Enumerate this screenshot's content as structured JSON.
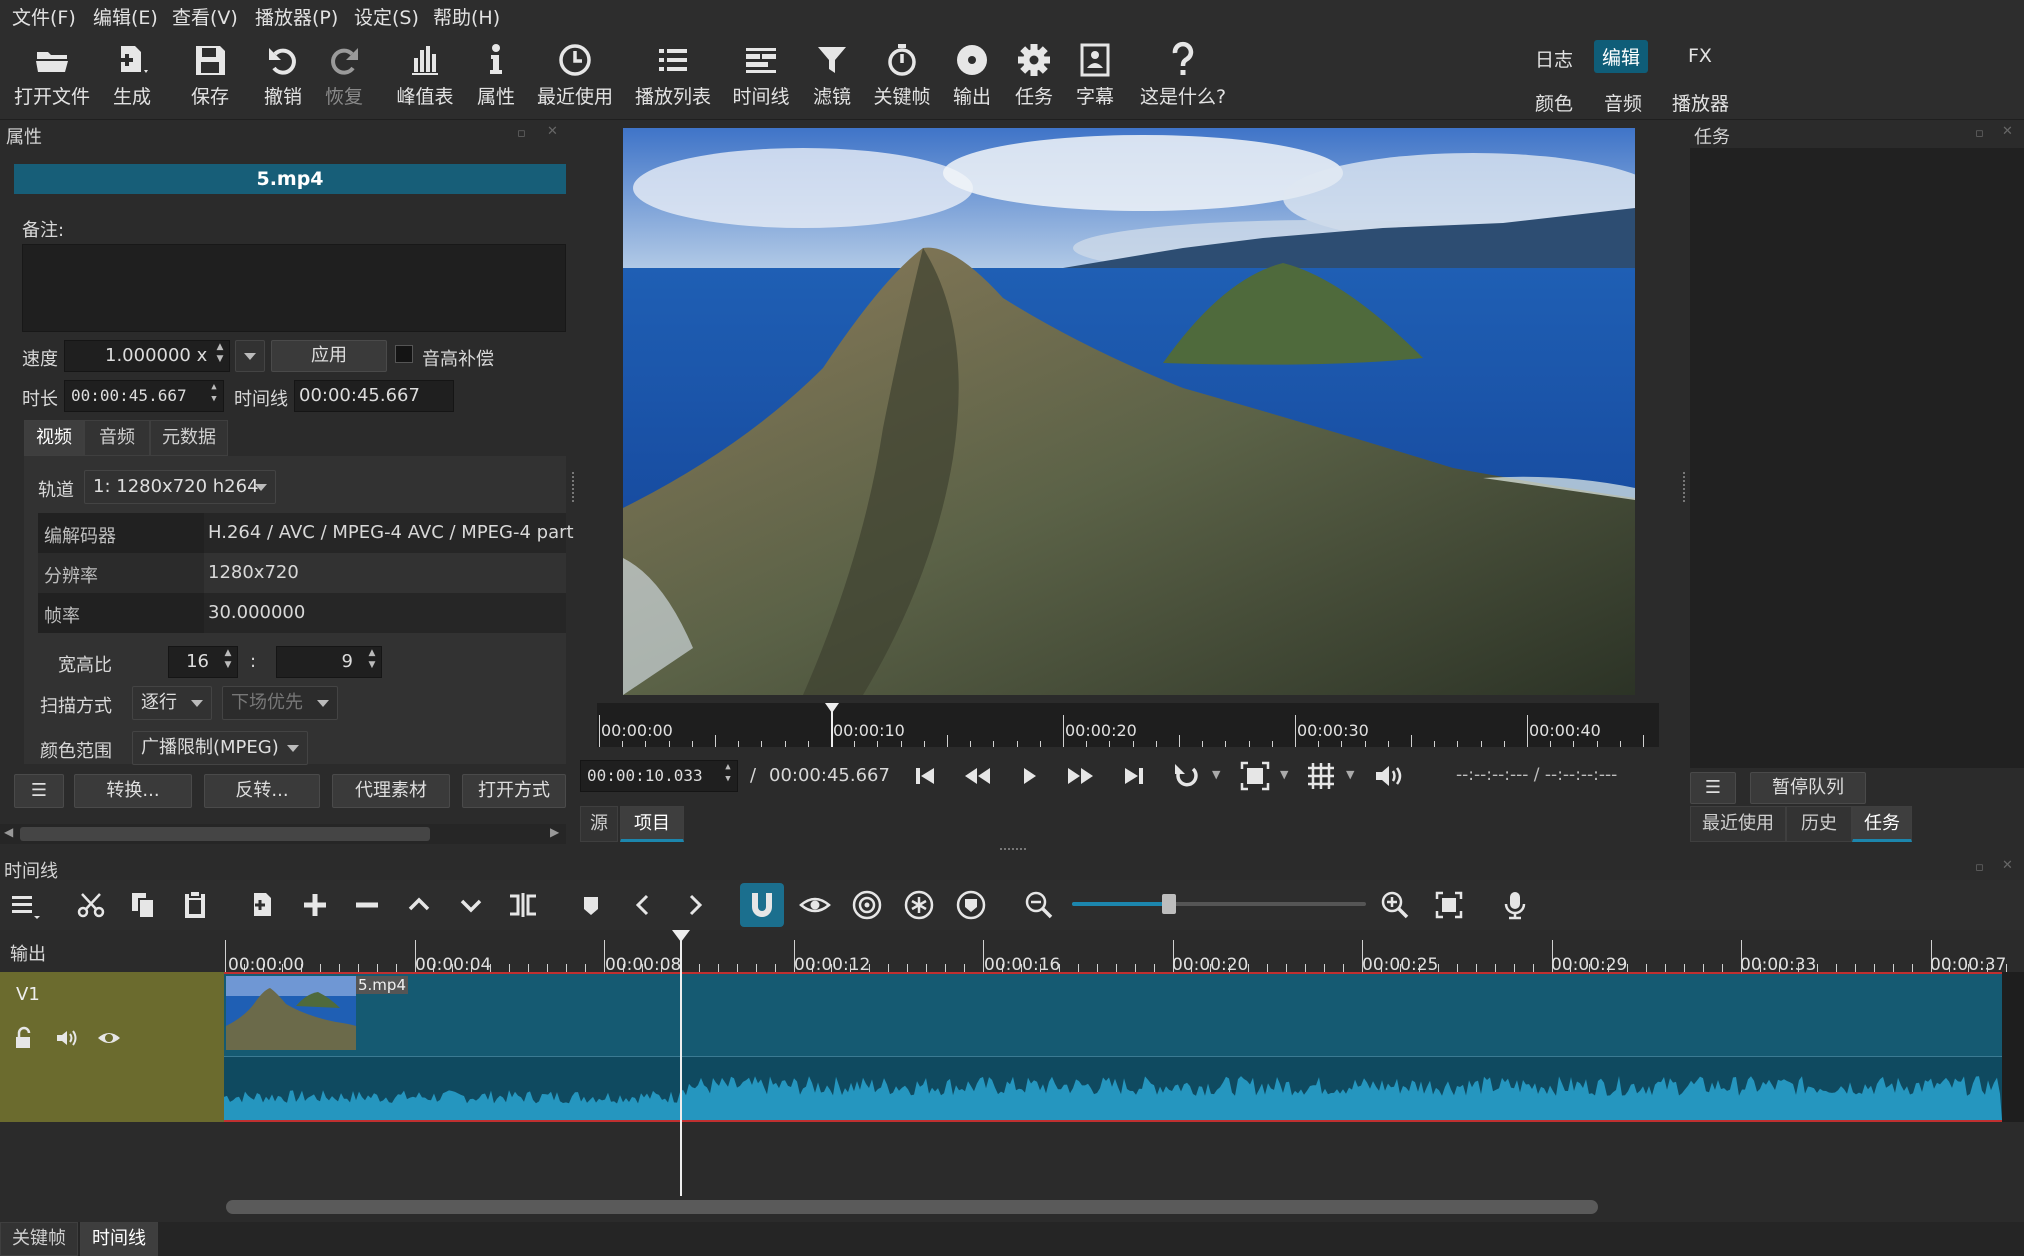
{
  "menu": [
    "文件(F)",
    "编辑(E)",
    "查看(V)",
    "播放器(P)",
    "设定(S)",
    "帮助(H)"
  ],
  "toolbar": {
    "buttons": [
      {
        "label": "打开文件",
        "icon": "open-folder-icon"
      },
      {
        "label": "生成",
        "icon": "generate-icon"
      },
      {
        "label": "保存",
        "icon": "save-icon"
      },
      {
        "label": "撤销",
        "icon": "undo-icon"
      },
      {
        "label": "恢复",
        "icon": "redo-icon"
      },
      {
        "label": "峰值表",
        "icon": "peak-meter-icon"
      },
      {
        "label": "属性",
        "icon": "info-icon"
      },
      {
        "label": "最近使用",
        "icon": "clock-icon"
      },
      {
        "label": "播放列表",
        "icon": "playlist-icon"
      },
      {
        "label": "时间线",
        "icon": "timeline-icon"
      },
      {
        "label": "滤镜",
        "icon": "filter-icon"
      },
      {
        "label": "关键帧",
        "icon": "stopwatch-icon"
      },
      {
        "label": "输出",
        "icon": "export-disc-icon"
      },
      {
        "label": "任务",
        "icon": "gear-icon"
      },
      {
        "label": "字幕",
        "icon": "subtitle-icon"
      },
      {
        "label": "这是什么?",
        "icon": "question-icon"
      }
    ],
    "workspaces_top": [
      "日志",
      "编辑",
      "FX"
    ],
    "workspaces_bottom": [
      "颜色",
      "音频",
      "播放器"
    ],
    "active_workspace": "编辑"
  },
  "properties": {
    "title": "属性",
    "file_name": "5.mp4",
    "notes_label": "备注:",
    "speed_label": "速度",
    "speed_value": "1.000000 x",
    "apply_label": "应用",
    "pitch_label": "音高补偿",
    "duration_label": "时长",
    "duration_value": "00:00:45.667",
    "timeline_label": "时间线",
    "timeline_value": "00:00:45.667",
    "tabs": [
      "视频",
      "音频",
      "元数据"
    ],
    "track_label": "轨道",
    "track_value": "1: 1280x720 h264",
    "rows": [
      {
        "key": "编解码器",
        "value": "H.264 / AVC / MPEG-4 AVC / MPEG-4 part"
      },
      {
        "key": "分辨率",
        "value": "1280x720"
      },
      {
        "key": "帧率",
        "value": "30.000000"
      }
    ],
    "aspect_label": "宽高比",
    "aspect_w": "16",
    "aspect_sep": ":",
    "aspect_h": "9",
    "scan_label": "扫描方式",
    "scan_value": "逐行",
    "field_order": "下场优先",
    "color_range_label": "颜色范围",
    "color_range_value": "广播限制(MPEG)",
    "bottom_buttons": [
      "转换...",
      "反转...",
      "代理素材",
      "打开方式"
    ]
  },
  "player": {
    "ruler_labels": [
      "00:00:00",
      "00:00:10",
      "00:00:20",
      "00:00:30",
      "00:00:40"
    ],
    "current_time": "00:00:10.033",
    "separator": "/",
    "total_time": "00:00:45.667",
    "in_out": "--:--:--:--- / --:--:--:---",
    "tabs": [
      "源",
      "项目"
    ],
    "active_tab": "项目"
  },
  "jobs": {
    "title": "任务",
    "pause_label": "暂停队列",
    "tabs": [
      "最近使用",
      "历史",
      "任务"
    ],
    "active_tab": "任务"
  },
  "timeline": {
    "title": "时间线",
    "output_label": "输出",
    "track_name": "V1",
    "clip_name": "5.mp4",
    "ruler_labels": [
      "00:00:00",
      "00:00:04",
      "00:00:08",
      "00:00:12",
      "00:00:16",
      "00:00:20",
      "00:00:25",
      "00:00:29",
      "00:00:33",
      "00:00:37"
    ],
    "zoom_level": 0.33,
    "bottom_tabs": [
      "关键帧",
      "时间线"
    ]
  }
}
